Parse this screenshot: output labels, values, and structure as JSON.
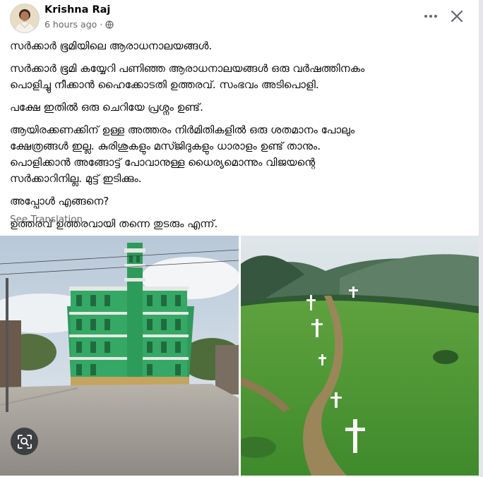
{
  "post": {
    "author": "Krishna Raj",
    "time": "6 hours ago",
    "time_separator": "·",
    "paragraphs": [
      "സർക്കാർ ഭൂമിയിലെ ആരാധനാലയങ്ങൾ.",
      "സർക്കാർ ഭൂമി കയ്യേറി പണിഞ്ഞ ആരാധനാലയങ്ങൾ ഒരു വർഷത്തിനകം\nപൊളിച്ചു നീക്കാൻ ഹൈക്കോടതി ഉത്തരവ്. സംഭവം അടിപൊളി.",
      "പക്ഷേ ഇതിൽ ഒരു ചെറിയേ പ്രശ്നം ഉണ്ട്.",
      "ആയിരക്കണക്കിന് ഉള്ള അത്തരം നിർമിതികളിൽ ഒരു ശതമാനം പോലും\nക്ഷേത്രങ്ങൾ ഇല്ല. കുരിശുകളും മസ്ജിദുകളും ധാരാളം ഉണ്ട് താനും.\nപൊളിക്കാൻ അങ്ങോട്ട് പോവാനുള്ള ധൈര്യമൊന്നും വിജയന്റെ\nസർക്കാറിനില്ല. മുട്ട് ഇടിക്കും.",
      "അപ്പോൾ എങ്ങനെ?",
      "ഉത്തരവ് ഉത്തരവായി തന്നെ തുടരും എന്ന്."
    ],
    "see_translation": "See Translation"
  },
  "icons": {
    "privacy": "globe-icon",
    "more": "more-horizontal-icon",
    "close": "close-icon",
    "lens": "visual-search-icon"
  },
  "colors": {
    "secondary_text": "#65676b",
    "primary_text": "#050505",
    "icon": "#606770"
  }
}
